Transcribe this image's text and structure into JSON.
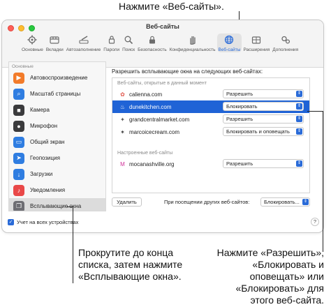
{
  "callouts": {
    "top": "Нажмите «Веб-сайты».",
    "left_lines": [
      "Прокрутите до конца",
      "списка, затем нажмите",
      "«Всплывающие окна»."
    ],
    "right_lines": [
      "Нажмите «Разрешить»,",
      "«Блокировать и",
      "оповещать» или",
      "«Блокировать» для",
      "этого веб-сайта."
    ]
  },
  "window": {
    "title": "Веб-сайты",
    "toolbar": [
      {
        "label": "Основные",
        "icon": "gear-icon"
      },
      {
        "label": "Вкладки",
        "icon": "tabs-icon"
      },
      {
        "label": "Автозаполнение",
        "icon": "pencil-icon"
      },
      {
        "label": "Пароли",
        "icon": "key-icon"
      },
      {
        "label": "Поиск",
        "icon": "search-icon"
      },
      {
        "label": "Безопасность",
        "icon": "lock-icon"
      },
      {
        "label": "Конфиденциальность",
        "icon": "hand-icon"
      },
      {
        "label": "Веб-сайты",
        "icon": "globe-icon",
        "active": true
      },
      {
        "label": "Расширения",
        "icon": "puzzle-icon"
      },
      {
        "label": "Дополнения",
        "icon": "gears-icon"
      }
    ]
  },
  "sidebar": {
    "header": "Основные",
    "items": [
      {
        "label": "Автовоспроизведение",
        "icon": "play-icon",
        "color": "#f27b2a"
      },
      {
        "label": "Масштаб страницы",
        "icon": "magnifier-icon",
        "color": "#2f7de1"
      },
      {
        "label": "Камера",
        "icon": "camera-icon",
        "color": "#3a3a3c"
      },
      {
        "label": "Микрофон",
        "icon": "microphone-icon",
        "color": "#3a3a3c"
      },
      {
        "label": "Общий экран",
        "icon": "screen-share-icon",
        "color": "#2f7de1"
      },
      {
        "label": "Геопозиция",
        "icon": "location-icon",
        "color": "#2f7de1"
      },
      {
        "label": "Загрузки",
        "icon": "download-icon",
        "color": "#2f7de1"
      },
      {
        "label": "Уведомления",
        "icon": "bell-icon",
        "color": "#e94848"
      },
      {
        "label": "Всплывающие окна",
        "icon": "popup-window-icon",
        "color": "#6e6e73",
        "selected": true
      }
    ]
  },
  "main": {
    "title": "Разрешить всплывающие окна на следующих веб-сайтах:",
    "open_group_label": "Веб-сайты, открытые в данный момент",
    "open_sites": [
      {
        "site": "calienna.com",
        "setting": "Разрешить",
        "fav_color": "#e0554a",
        "fav": "✿"
      },
      {
        "site": "dunekitchen.com",
        "setting": "Блокировать",
        "fav_color": "#ffffff",
        "fav": "♨",
        "selected": true
      },
      {
        "site": "grandcentralmarket.com",
        "setting": "Разрешить",
        "fav_color": "#555555",
        "fav": "✦"
      },
      {
        "site": "marcoicecream.com",
        "setting": "Блокировать и оповещать",
        "fav_color": "#333333",
        "fav": "✶"
      }
    ],
    "configured_group_label": "Настроенные веб-сайты",
    "configured_sites": [
      {
        "site": "mocanashville.org",
        "setting": "Разрешить",
        "fav_color": "#d0339a",
        "fav": "M"
      }
    ],
    "delete_label": "Удалить",
    "other_sites_label": "При посещении других веб-сайтов:",
    "other_sites_value": "Блокировать..."
  },
  "footer": {
    "sync_label": "Учет на всех устройствах",
    "help_label": "?"
  }
}
